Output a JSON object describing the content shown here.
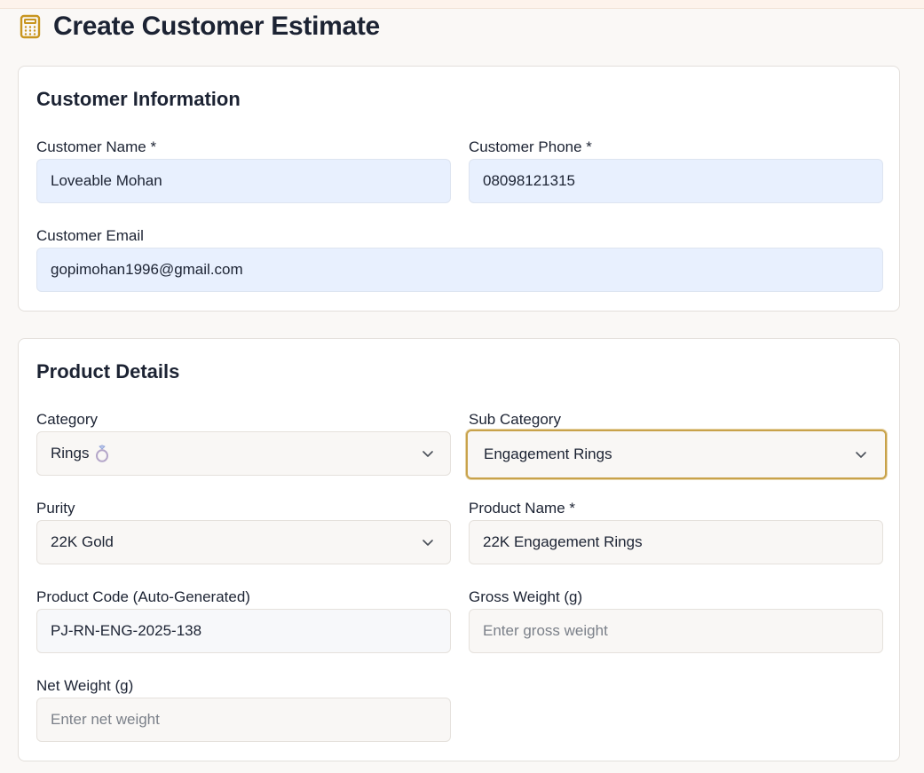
{
  "page": {
    "title": "Create Customer Estimate",
    "icon": "calculator-icon"
  },
  "customer_section": {
    "title": "Customer Information",
    "name": {
      "label": "Customer Name *",
      "value": "Loveable Mohan"
    },
    "phone": {
      "label": "Customer Phone *",
      "value": "08098121315"
    },
    "email": {
      "label": "Customer Email",
      "value": "gopimohan1996@gmail.com"
    }
  },
  "product_section": {
    "title": "Product Details",
    "category": {
      "label": "Category",
      "value": "Rings",
      "icon": "ring-icon"
    },
    "sub_category": {
      "label": "Sub Category",
      "value": "Engagement Rings"
    },
    "purity": {
      "label": "Purity",
      "value": "22K Gold"
    },
    "product_name": {
      "label": "Product Name *",
      "value": "22K Engagement Rings"
    },
    "product_code": {
      "label": "Product Code (Auto-Generated)",
      "value": "PJ-RN-ENG-2025-138"
    },
    "gross_weight": {
      "label": "Gross Weight (g)",
      "value": "",
      "placeholder": "Enter gross weight"
    },
    "net_weight": {
      "label": "Net Weight (g)",
      "value": "",
      "placeholder": "Enter net weight"
    }
  },
  "colors": {
    "accent": "#c8a24a",
    "title_text": "#1c2333",
    "autofill_bg": "#e8f0fe",
    "field_bg": "#f9f7f5"
  }
}
